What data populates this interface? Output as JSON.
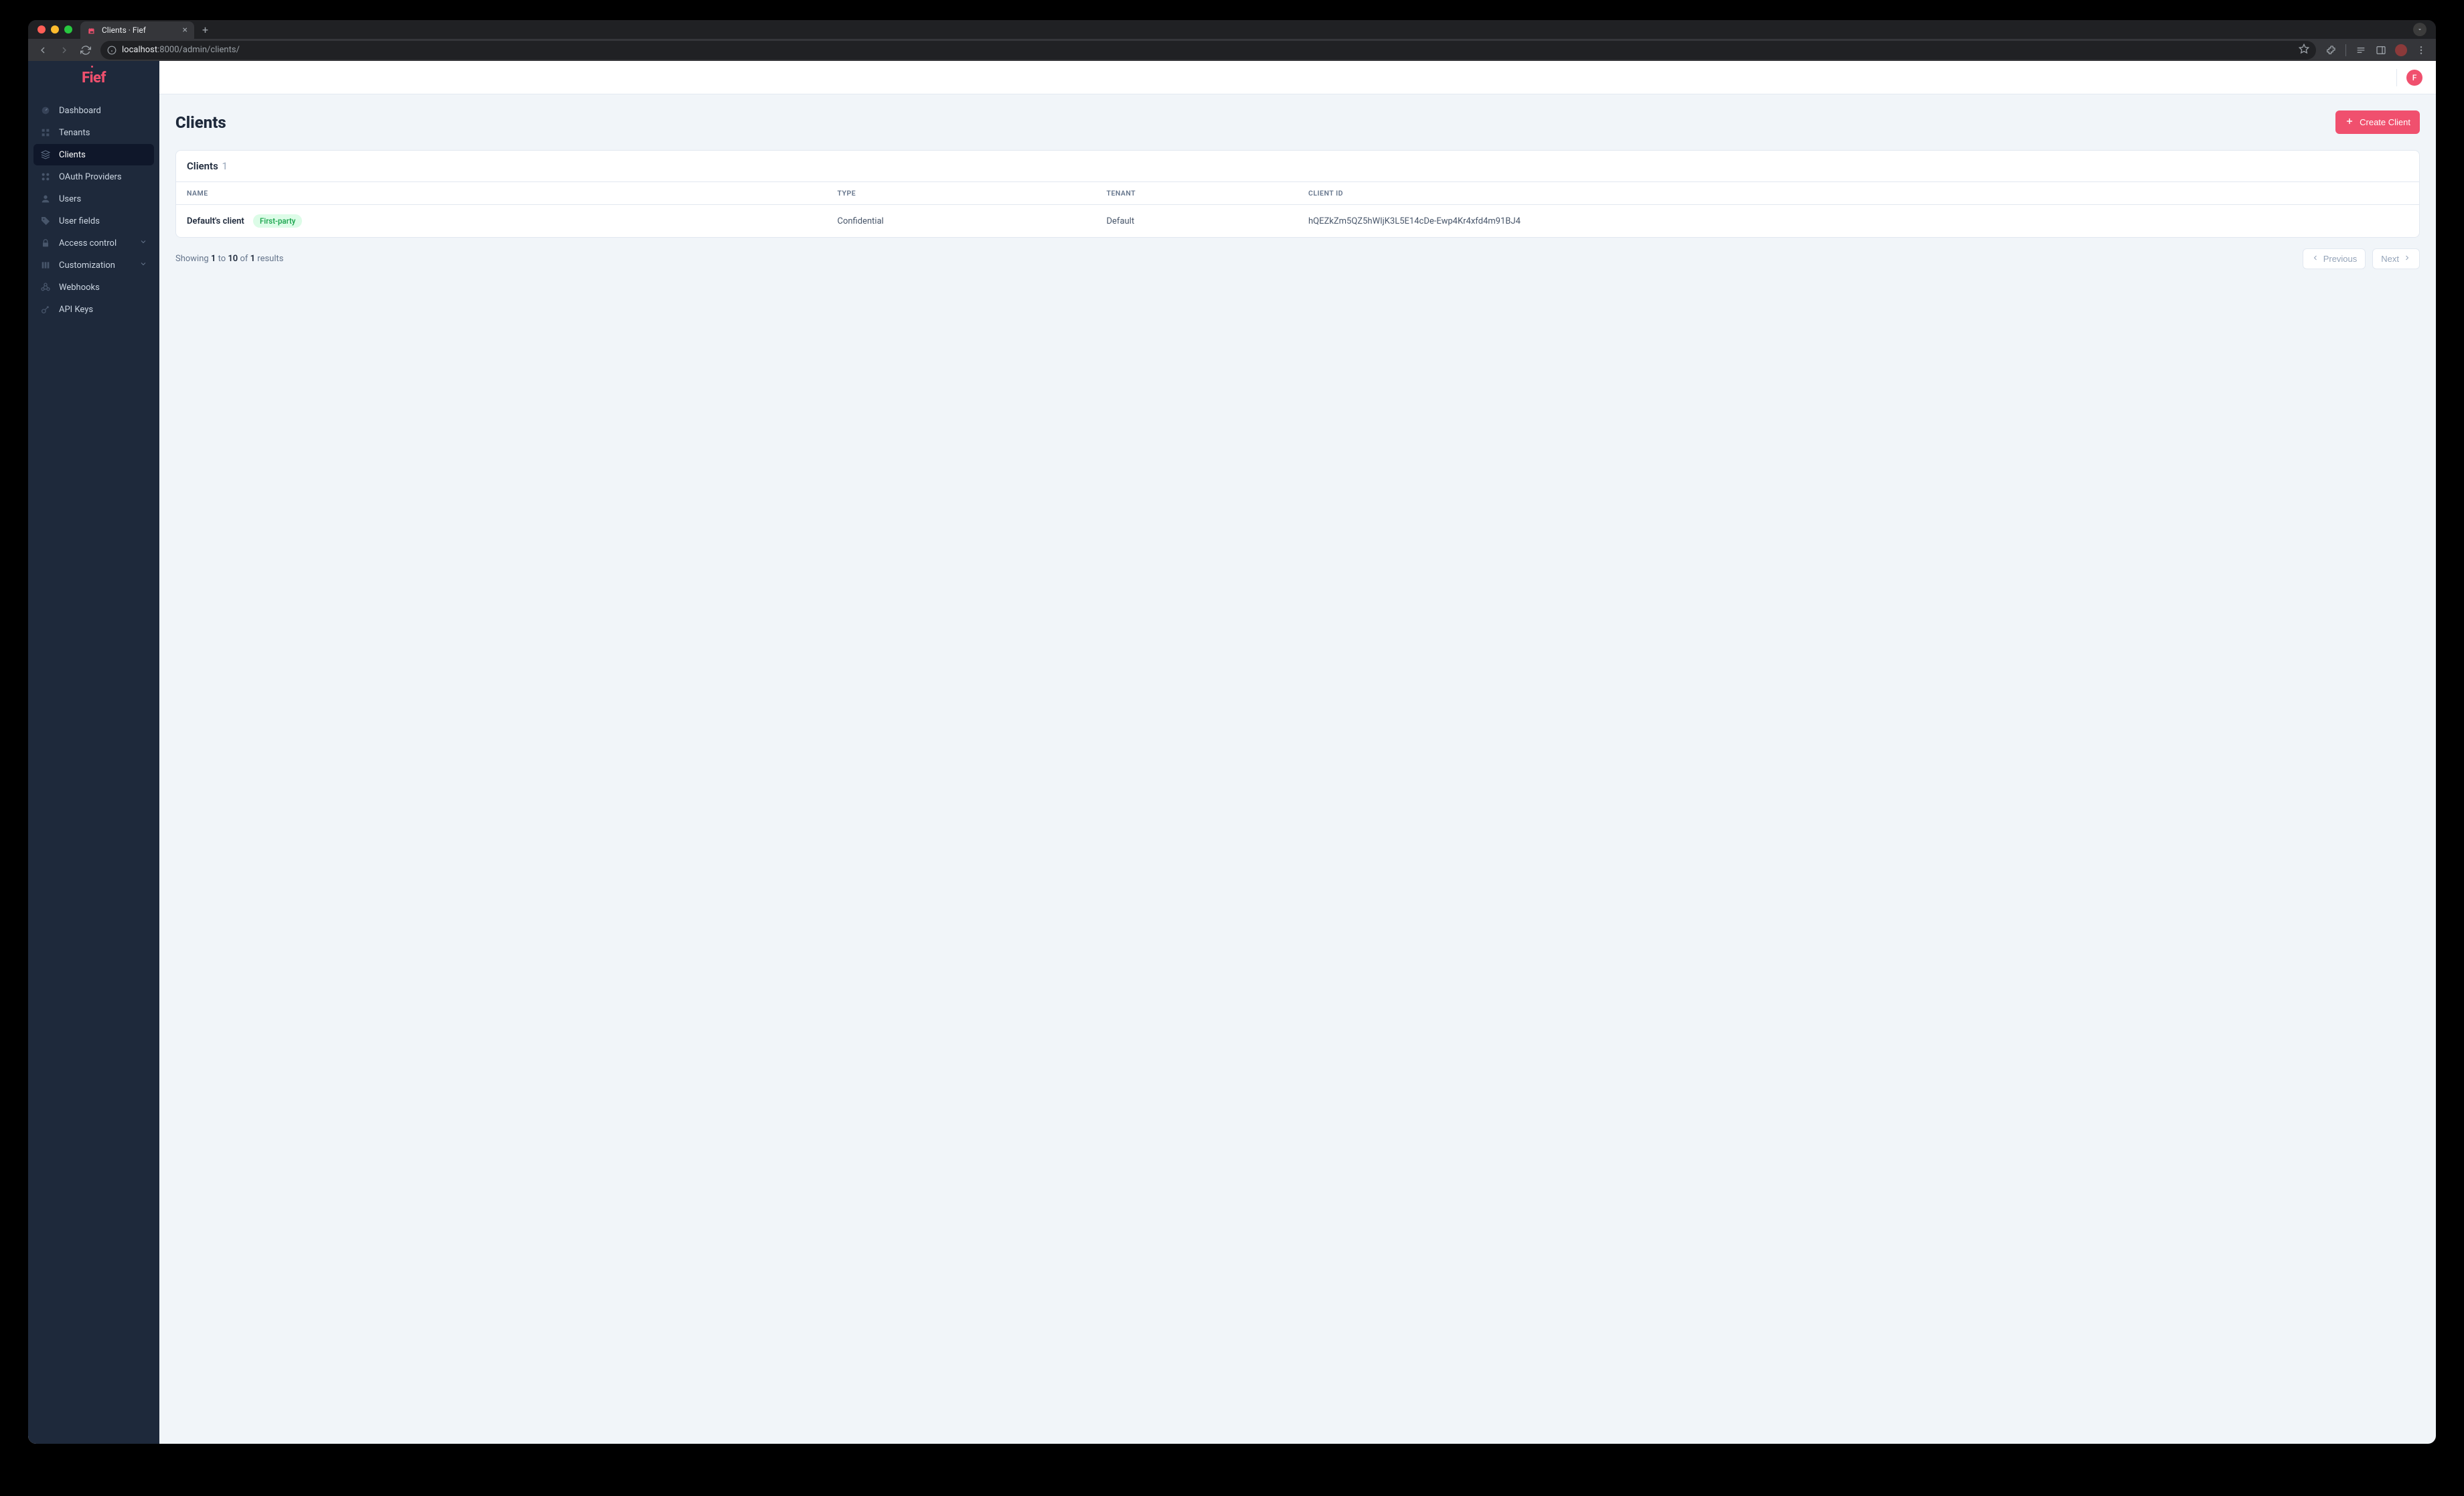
{
  "browser": {
    "tab_title": "Clients · Fief",
    "url_host": "localhost",
    "url_path": ":8000/admin/clients/"
  },
  "brand": "Fief",
  "sidebar": {
    "items": [
      {
        "label": "Dashboard",
        "icon": "dashboard"
      },
      {
        "label": "Tenants",
        "icon": "tenants"
      },
      {
        "label": "Clients",
        "icon": "clients",
        "active": true
      },
      {
        "label": "OAuth Providers",
        "icon": "oauth"
      },
      {
        "label": "Users",
        "icon": "users"
      },
      {
        "label": "User fields",
        "icon": "userfields"
      },
      {
        "label": "Access control",
        "icon": "lock",
        "expandable": true
      },
      {
        "label": "Customization",
        "icon": "customization",
        "expandable": true
      },
      {
        "label": "Webhooks",
        "icon": "webhooks"
      },
      {
        "label": "API Keys",
        "icon": "apikeys"
      }
    ]
  },
  "topbar": {
    "avatar_initial": "F"
  },
  "page": {
    "title": "Clients",
    "create_button": "Create Client",
    "card_title": "Clients",
    "card_count": "1",
    "columns": {
      "name": "NAME",
      "type": "TYPE",
      "tenant": "TENANT",
      "client_id": "CLIENT ID"
    },
    "rows": [
      {
        "name": "Default's client",
        "badge": "First-party",
        "type": "Confidential",
        "tenant": "Default",
        "client_id": "hQEZkZm5QZ5hWIjK3L5E14cDe-Ewp4Kr4xfd4m91BJ4"
      }
    ],
    "pagination": {
      "prefix": "Showing ",
      "from": "1",
      "to_word": " to ",
      "to": "10",
      "of_word": " of ",
      "total": "1",
      "suffix": " results",
      "prev": "Previous",
      "next": "Next"
    }
  }
}
